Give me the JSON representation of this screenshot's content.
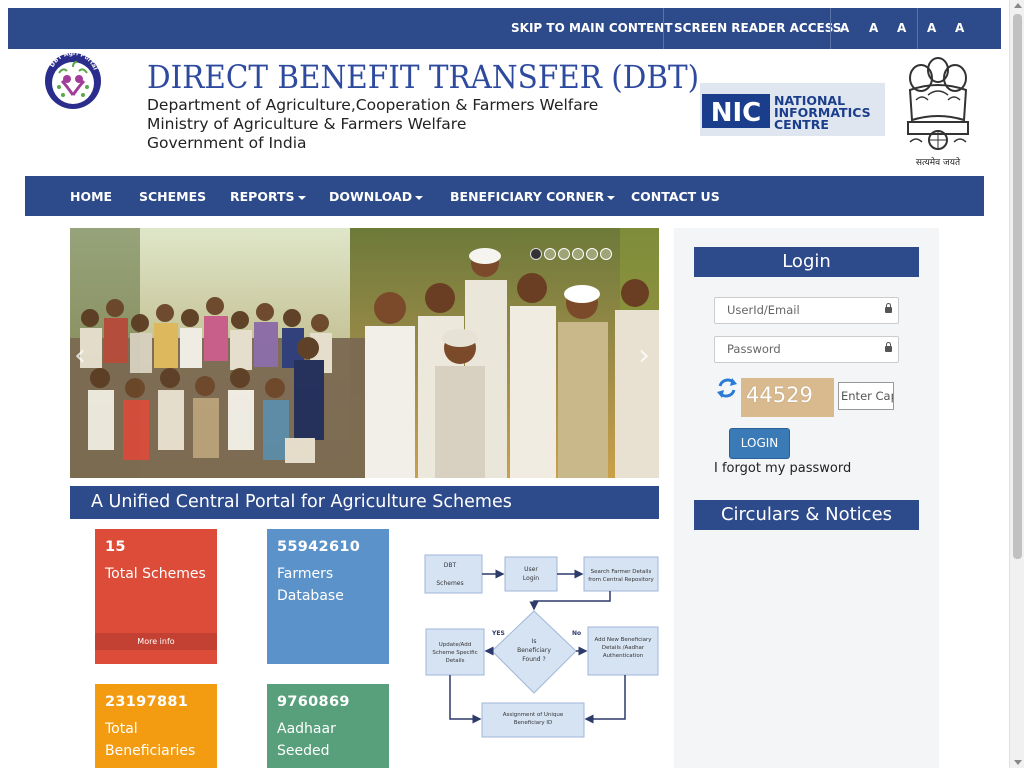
{
  "topbar": {
    "skip_label": "SKIP TO MAIN CONTENT",
    "screen_reader_label": "SCREEN READER ACCESS",
    "font_sizes": [
      "A",
      "A",
      "A",
      "A",
      "A"
    ]
  },
  "header": {
    "logo_text": "DBT Agri Portal",
    "title": "DIRECT BENEFIT TRANSFER (DBT)",
    "lines": [
      "Department of Agriculture,Cooperation & Farmers Welfare",
      "Ministry of Agriculture & Farmers Welfare",
      "Government of India"
    ],
    "nic_abbr": "NIC",
    "nic_name_1": "NATIONAL",
    "nic_name_2": "INFORMATICS",
    "nic_name_3": "CENTRE",
    "emblem_motto": "सत्यमेव जयते"
  },
  "nav": {
    "items": [
      {
        "label": "HOME",
        "dropdown": false
      },
      {
        "label": "SCHEMES",
        "dropdown": false
      },
      {
        "label": "REPORTS",
        "dropdown": true
      },
      {
        "label": "DOWNLOAD",
        "dropdown": true
      },
      {
        "label": "BENEFICIARY CORNER",
        "dropdown": true
      },
      {
        "label": "CONTACT US",
        "dropdown": false
      }
    ]
  },
  "carousel": {
    "slide_count": 6,
    "active_index": 0
  },
  "main": {
    "portal_tagline": "A Unified Central Portal for Agriculture Schemes",
    "stats": [
      {
        "value": "15",
        "label": "Total Schemes",
        "more": "More info",
        "color": "#dd4b39"
      },
      {
        "value": "55942610",
        "label": "Farmers Database",
        "color": "#5b92c9"
      },
      {
        "value": "23197881",
        "label": "Total Beneficiaries",
        "color": "#f39c12"
      },
      {
        "value": "9760869",
        "label": "Aadhaar Seeded",
        "color": "#58a07b"
      }
    ],
    "flow": {
      "dbt_schemes_1": "DBT",
      "dbt_schemes_2": "Schemes",
      "user_login_1": "User",
      "user_login_2": "Login",
      "search_1": "Search Farmer Details",
      "search_2": "from Central Repository",
      "decision_1": "Is",
      "decision_2": "Beneficiary",
      "decision_3": "Found ?",
      "yes": "YES",
      "no": "No",
      "update_1": "Update/Add",
      "update_2": "Scheme Specific",
      "update_3": "Details",
      "add_new_1": "Add New Beneficiary",
      "add_new_2": "Details /Aadhar",
      "add_new_3": "Authentication",
      "assign_1": "Assignment of Unique",
      "assign_2": "Beneficiary ID"
    }
  },
  "login": {
    "heading": "Login",
    "user_placeholder": "UserId/Email",
    "password_placeholder": "Password",
    "captcha_value": "44529",
    "captcha_placeholder": "Enter Captcha",
    "button_label": "LOGIN",
    "forgot_label": "I forgot my password"
  },
  "circulars": {
    "heading": "Circulars & Notices"
  },
  "colors": {
    "brand_blue": "#2d4a8a",
    "title_blue": "#2d4a9e",
    "login_button": "#3a7ab6"
  }
}
